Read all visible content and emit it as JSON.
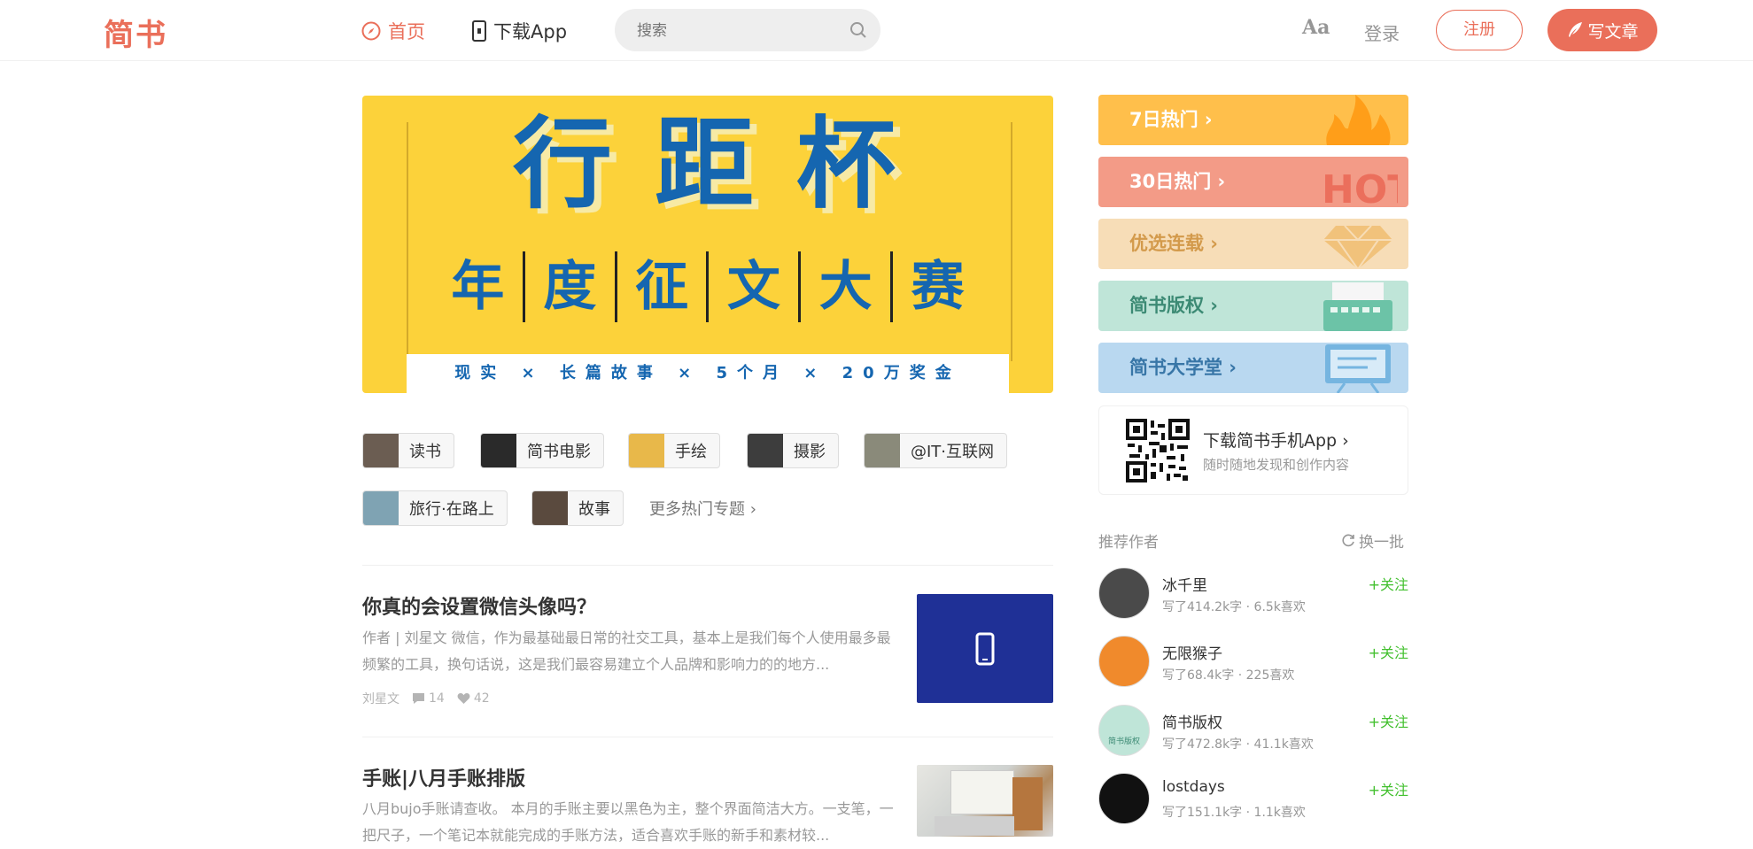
{
  "header": {
    "logo": "简书",
    "nav_home": "首页",
    "nav_app": "下载App",
    "search_placeholder": "搜索",
    "font_toggle": "Aa",
    "login": "登录",
    "register": "注册",
    "write": "写文章"
  },
  "banner": {
    "title": "行距杯",
    "subtitle": [
      "年",
      "度",
      "征",
      "文",
      "大",
      "赛"
    ],
    "strip": "现实 × 长篇故事 × 5个月 × 20万奖金"
  },
  "topics": [
    {
      "label": "读书",
      "thumb": "#6b5d52"
    },
    {
      "label": "简书电影",
      "thumb": "#2a2a2a"
    },
    {
      "label": "手绘",
      "thumb": "#e8b84a"
    },
    {
      "label": "摄影",
      "thumb": "#3d3d3d"
    },
    {
      "label": "@IT·互联网",
      "thumb": "#8a8a7a"
    },
    {
      "label": "旅行·在路上",
      "thumb": "#7fa3b3"
    },
    {
      "label": "故事",
      "thumb": "#5a4a3e"
    }
  ],
  "more_topics": "更多热门专题",
  "articles": [
    {
      "title": "你真的会设置微信头像吗？",
      "abstract": "作者 | 刘星文 微信，作为最基础最日常的社交工具，基本上是我们每个人使用最多最频繁的工具，换句话说，这是我们最容易建立个人品牌和影响力的的地方...",
      "author": "刘星文",
      "comments": "14",
      "likes": "42"
    },
    {
      "title": "手账|八月手账排版",
      "abstract": "八月bujo手账请查收。 本月的手账主要以黑色为主，整个界面简洁大方。一支笔，一把尺子，一个笔记本就能完成的手账方法，适合喜欢手账的新手和素材较..."
    }
  ],
  "boards": [
    {
      "label": "7日热门 ›",
      "color": "#ffbf4b",
      "icon": "fire-icon"
    },
    {
      "label": "30日热门 ›",
      "color": "#f39b87",
      "icon": "hot-icon"
    },
    {
      "label": "优选连载 ›",
      "color": "#f7ddb7",
      "icon": "diamond-icon",
      "text_color": "#d39a4b"
    },
    {
      "label": "简书版权 ›",
      "color": "#bfe5d8",
      "icon": "typewriter-icon",
      "text_color": "#3c8a74"
    },
    {
      "label": "简书大学堂 ›",
      "color": "#b9d8f0",
      "icon": "board-icon",
      "text_color": "#3876a7"
    }
  ],
  "app_download": {
    "title": "下载简书手机App",
    "desc": "随时随地发现和创作内容"
  },
  "recommend": {
    "title": "推荐作者",
    "refresh": "换一批",
    "follow": "+关注",
    "authors": [
      {
        "name": "冰千里",
        "info": "写了414.2k字 · 6.5k喜欢",
        "avatar": "#4a4a4a"
      },
      {
        "name": "无限猴子",
        "info": "写了68.4k字 · 225喜欢",
        "avatar": "#f08a2c"
      },
      {
        "name": "简书版权",
        "info": "写了472.8k字 · 41.1k喜欢",
        "avatar": "#bfe5d8",
        "avatar_text": "简书版权"
      },
      {
        "name": "lostdays",
        "info": "写了151.1k字 · 1.1k喜欢",
        "avatar": "#111111"
      }
    ]
  },
  "colors": {
    "brand": "#ea6f5a",
    "follow": "#42c02e"
  }
}
